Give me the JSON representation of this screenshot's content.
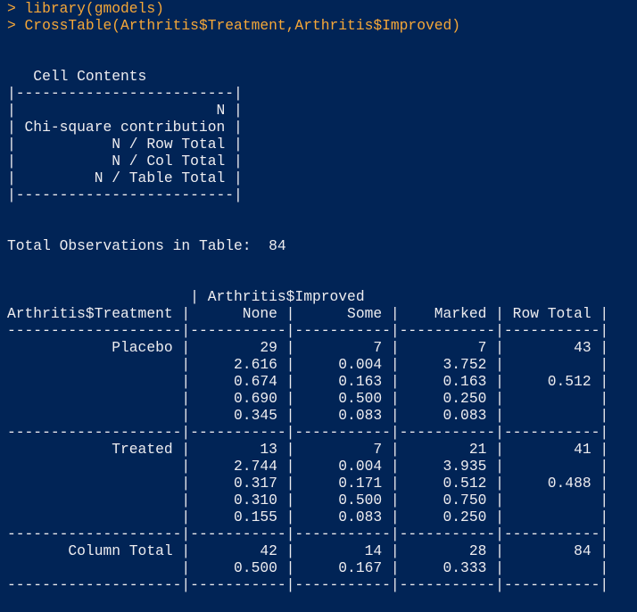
{
  "window": {
    "background": "#012456",
    "command_color": "#f6a738",
    "output_color": "#eeedf0"
  },
  "console": {
    "lines": [
      {
        "kind": "cmd",
        "text": "> library(gmodels)"
      },
      {
        "kind": "cmd",
        "text": "> CrossTable(Arthritis$Treatment,Arthritis$Improved)"
      },
      {
        "kind": "out",
        "text": ""
      },
      {
        "kind": "out",
        "text": ""
      },
      {
        "kind": "out",
        "text": "   Cell Contents"
      },
      {
        "kind": "out",
        "text": "|-------------------------|"
      },
      {
        "kind": "out",
        "text": "|                       N |"
      },
      {
        "kind": "out",
        "text": "| Chi-square contribution |"
      },
      {
        "kind": "out",
        "text": "|           N / Row Total |"
      },
      {
        "kind": "out",
        "text": "|           N / Col Total |"
      },
      {
        "kind": "out",
        "text": "|         N / Table Total |"
      },
      {
        "kind": "out",
        "text": "|-------------------------|"
      },
      {
        "kind": "out",
        "text": ""
      },
      {
        "kind": "out",
        "text": ""
      },
      {
        "kind": "out",
        "text": "Total Observations in Table:  84"
      },
      {
        "kind": "out",
        "text": ""
      },
      {
        "kind": "out",
        "text": ""
      },
      {
        "kind": "out",
        "text": "                     | Arthritis$Improved"
      },
      {
        "kind": "out",
        "text": "Arthritis$Treatment |      None |      Some |    Marked | Row Total |"
      },
      {
        "kind": "out",
        "text": "--------------------|-----------|-----------|-----------|-----------|"
      },
      {
        "kind": "out",
        "text": "            Placebo |        29 |         7 |         7 |        43 |"
      },
      {
        "kind": "out",
        "text": "                    |     2.616 |     0.004 |     3.752 |           |"
      },
      {
        "kind": "out",
        "text": "                    |     0.674 |     0.163 |     0.163 |     0.512 |"
      },
      {
        "kind": "out",
        "text": "                    |     0.690 |     0.500 |     0.250 |           |"
      },
      {
        "kind": "out",
        "text": "                    |     0.345 |     0.083 |     0.083 |           |"
      },
      {
        "kind": "out",
        "text": "--------------------|-----------|-----------|-----------|-----------|"
      },
      {
        "kind": "out",
        "text": "            Treated |        13 |         7 |        21 |        41 |"
      },
      {
        "kind": "out",
        "text": "                    |     2.744 |     0.004 |     3.935 |           |"
      },
      {
        "kind": "out",
        "text": "                    |     0.317 |     0.171 |     0.512 |     0.488 |"
      },
      {
        "kind": "out",
        "text": "                    |     0.310 |     0.500 |     0.750 |           |"
      },
      {
        "kind": "out",
        "text": "                    |     0.155 |     0.083 |     0.250 |           |"
      },
      {
        "kind": "out",
        "text": "--------------------|-----------|-----------|-----------|-----------|"
      },
      {
        "kind": "out",
        "text": "       Column Total |        42 |        14 |        28 |        84 |"
      },
      {
        "kind": "out",
        "text": "                    |     0.500 |     0.167 |     0.333 |           |"
      },
      {
        "kind": "out",
        "text": "--------------------|-----------|-----------|-----------|-----------|"
      }
    ]
  }
}
